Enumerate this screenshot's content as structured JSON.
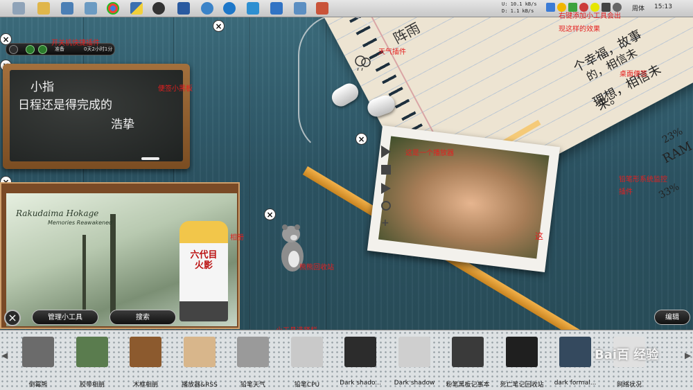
{
  "taskbar": {
    "icons": [
      "recycle-icon",
      "folder-icon",
      "computer-icon",
      "image-icon",
      "chrome-icon",
      "python-icon",
      "qq-icon",
      "calculator-icon",
      "globe-icon",
      "clock-icon",
      "cube-icon",
      "windows-icon",
      "monitor-icon",
      "app-icon"
    ],
    "net_up": "U:  10.1 kB/s",
    "net_down": "D:   1.1 kB/s",
    "weekday": "周体",
    "clock": "15:13"
  },
  "shutdown_gadget": {
    "status": "准备",
    "uptime": "0天2小时1分"
  },
  "blackboard": {
    "line1": "小指",
    "line2": "日程还是得完成的",
    "line3": "浩挚"
  },
  "photo_frame": {
    "title": "Rakudaima Hokage",
    "subtitle": "Memories Reawakened",
    "kanji": "六代目火影"
  },
  "buttons": {
    "manage": "管理小工具",
    "search": "搜索",
    "edit": "编辑",
    "close": "×"
  },
  "weather": {
    "city": "阵雨"
  },
  "handwriting": {
    "note1": "个幸福，故事",
    "note2": "的，相信未",
    "note3": "理想，相信未",
    "note4": "来。",
    "cpu": "23%",
    "ram": "RAM",
    "cpu2": "33%"
  },
  "annotations": {
    "shutdown": "开关机快捷插件",
    "weather": "天气插件",
    "right_click": "右键添加小工具会出",
    "right_click2": "现这样的效果",
    "memo": "便签小黑板",
    "desk_memo": "桌面便签",
    "player": "这是一个播放器",
    "sysmon": "铅笔形系统监控",
    "sysmon2": "插件",
    "album": "相册",
    "bear": "熊熊回收站",
    "gallery": "小工具选择栏",
    "doodle": "这"
  },
  "gallery": {
    "items": [
      {
        "label": "倒霉熊",
        "color": "#6b6b6b"
      },
      {
        "label": "胶带相册",
        "color": "#5a7c4e"
      },
      {
        "label": "木框相册",
        "color": "#8c5a2e"
      },
      {
        "label": "播放器&RSS",
        "color": "#d8b68b"
      },
      {
        "label": "铅笔天气",
        "color": "#9a9a9a"
      },
      {
        "label": "铅笔CPU",
        "color": "#c9c9c9"
      },
      {
        "label": "Dark shado...",
        "color": "#2c2c2c"
      },
      {
        "label": "Dark shadow",
        "color": "#cfcfcf"
      },
      {
        "label": "粉笔黑板记事本",
        "color": "#3a3a3a"
      },
      {
        "label": "死亡笔记回收站",
        "color": "#1f1f1f"
      },
      {
        "label": "dark formal...",
        "color": "#34495e"
      },
      {
        "label": "网络状况",
        "color": "#e0e0e0"
      }
    ]
  },
  "watermark": "Bai百 经验"
}
